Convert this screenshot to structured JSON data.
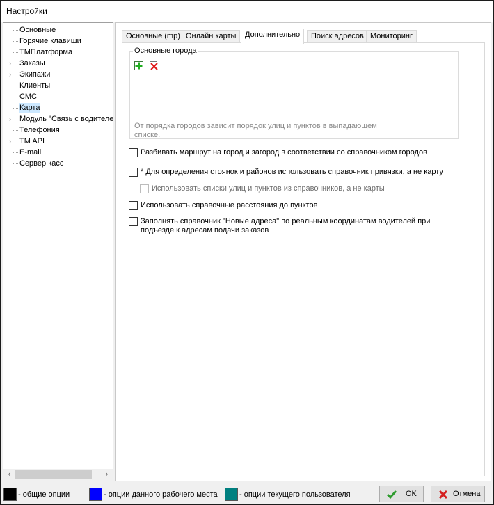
{
  "window": {
    "title": "Настройки"
  },
  "tree": {
    "items": [
      {
        "label": "Основные",
        "expandable": false,
        "selected": false
      },
      {
        "label": "Горячие клавиши",
        "expandable": false,
        "selected": false
      },
      {
        "label": "ТМПлатформа",
        "expandable": false,
        "selected": false
      },
      {
        "label": "Заказы",
        "expandable": true,
        "selected": false
      },
      {
        "label": "Экипажи",
        "expandable": true,
        "selected": false
      },
      {
        "label": "Клиенты",
        "expandable": false,
        "selected": false
      },
      {
        "label": "СМС",
        "expandable": false,
        "selected": false
      },
      {
        "label": "Карта",
        "expandable": false,
        "selected": true
      },
      {
        "label": "Модуль \"Связь с водителем\"",
        "expandable": true,
        "selected": false
      },
      {
        "label": "Телефония",
        "expandable": false,
        "selected": false
      },
      {
        "label": "TM API",
        "expandable": true,
        "selected": false
      },
      {
        "label": "E-mail",
        "expandable": false,
        "selected": false
      },
      {
        "label": "Сервер касс",
        "expandable": false,
        "selected": false
      }
    ]
  },
  "tabs": [
    {
      "label": "Основные (mp)",
      "active": false
    },
    {
      "label": "Онлайн карты",
      "active": false
    },
    {
      "label": "Дополнительно",
      "active": true
    },
    {
      "label": "Поиск адресов",
      "active": false
    },
    {
      "label": "Мониторинг",
      "active": false
    }
  ],
  "cities_group": {
    "title": "Основные города",
    "hint": "От порядка городов зависит порядок улиц и пунктов в выпадающем списке.",
    "add_icon": "add-green-plus-icon",
    "delete_icon": "delete-red-x-icon"
  },
  "options": [
    {
      "label": "Разбивать маршрут на город и загород в соответствии со справочником  городов",
      "checked": false,
      "disabled": false
    },
    {
      "label": "* Для определения стоянок и районов использовать справочник привязки, а не карту",
      "checked": false,
      "disabled": false
    },
    {
      "label": "Использовать списки улиц и пунктов из справочников, а не карты",
      "checked": false,
      "disabled": true
    },
    {
      "label": "Использовать справочные расстояния до пунктов",
      "checked": false,
      "disabled": false
    },
    {
      "label_line1": "Заполнять справочник \"Новые адреса\" по реальным координатам водителей при",
      "label_line2": "подъезде к адресам подачи заказов",
      "checked": false,
      "disabled": false
    }
  ],
  "legend": [
    {
      "label": "- общие опции",
      "color": "#000000"
    },
    {
      "label": "- опции данного рабочего места",
      "color": "#0000ff"
    },
    {
      "label": "- опции текущего пользователя",
      "color": "#008080"
    }
  ],
  "buttons": {
    "ok_label": "OK",
    "cancel_label": "Отмена"
  }
}
